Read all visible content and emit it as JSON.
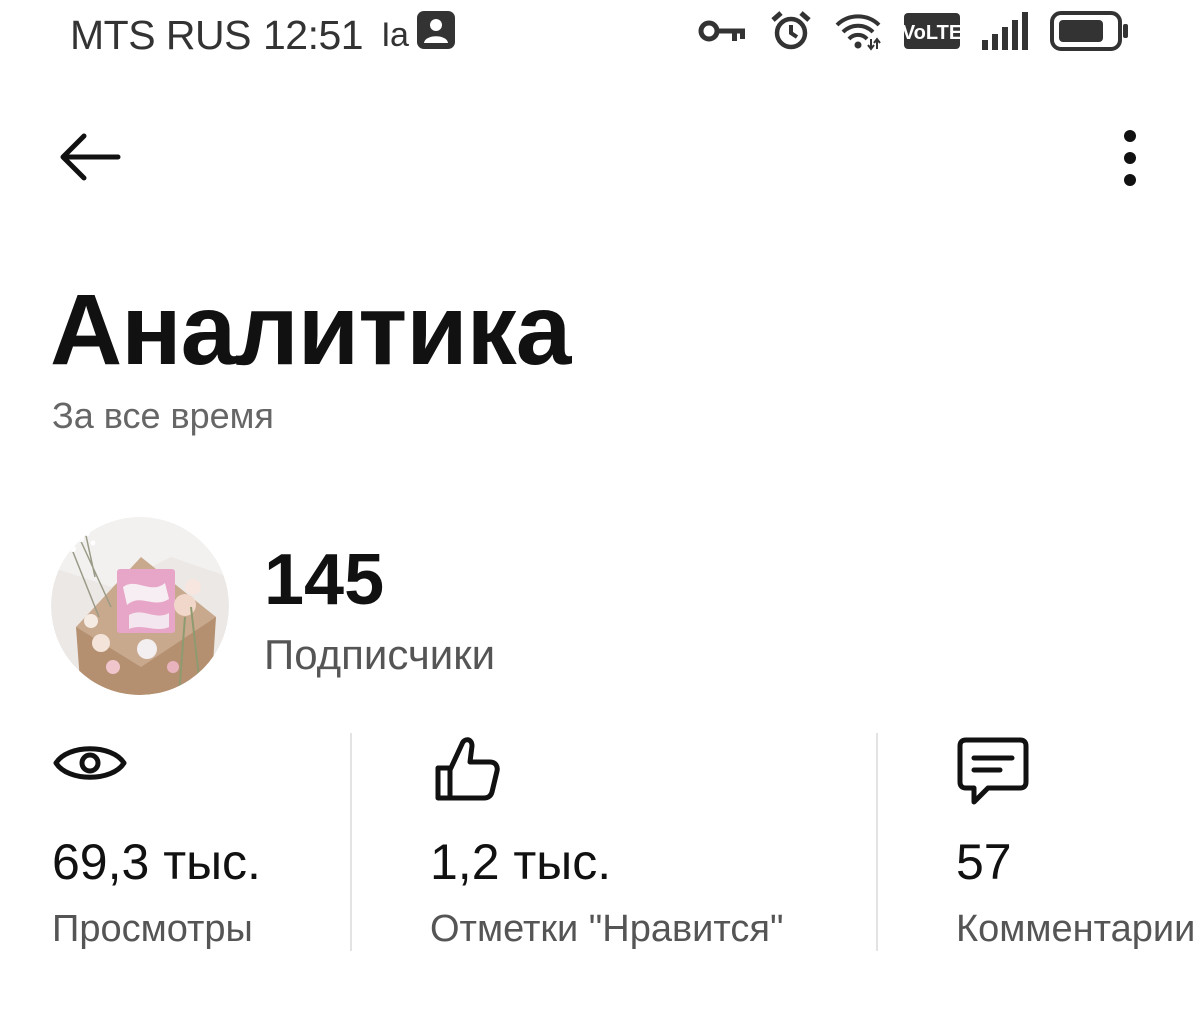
{
  "status_bar": {
    "carrier": "MTS RUS",
    "time": "12:51",
    "extra": "Ia",
    "network_badge": "VoLTE",
    "icons": [
      "contact-icon",
      "key-icon",
      "alarm-icon",
      "wifi-icon",
      "volte-icon",
      "signal-icon",
      "battery-icon"
    ]
  },
  "toolbar": {
    "back_icon": "arrow-left-icon",
    "more_icon": "more-vertical-icon"
  },
  "header": {
    "title": "Аналитика",
    "subtitle": "За все время"
  },
  "followers": {
    "count": "145",
    "label": "Подписчики"
  },
  "stats": [
    {
      "icon": "eye-icon",
      "value": "69,3 тыс.",
      "label": "Просмотры"
    },
    {
      "icon": "thumbs-up-icon",
      "value": "1,2 тыс.",
      "label": "Отметки \"Нравится\""
    },
    {
      "icon": "comment-icon",
      "value": "57",
      "label": "Комментарии"
    }
  ],
  "colors": {
    "text_primary": "#111111",
    "text_secondary": "#555555",
    "subtitle": "#666666",
    "divider": "#e3e3e3",
    "background": "#ffffff"
  }
}
